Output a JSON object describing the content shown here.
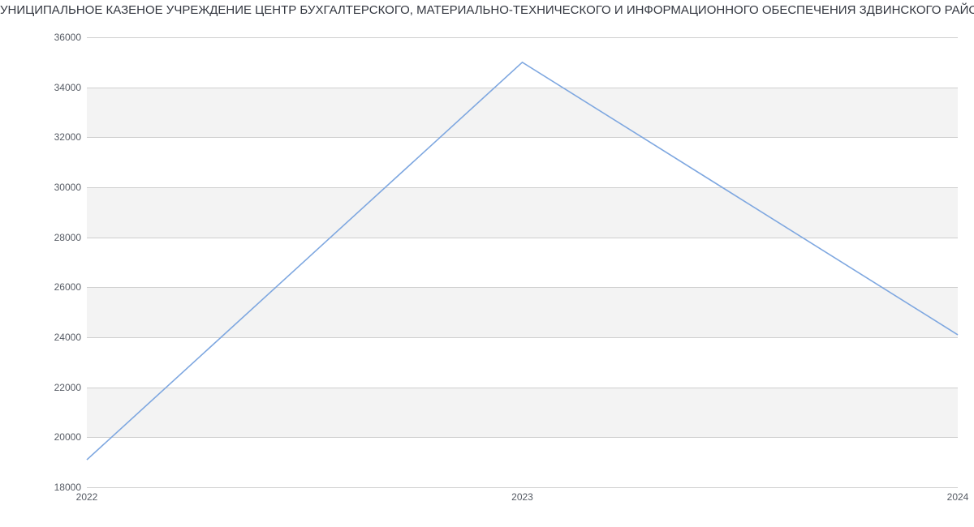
{
  "chart_data": {
    "type": "line",
    "title": "УНИЦИПАЛЬНОЕ КАЗЕНОЕ УЧРЕЖДЕНИЕ  ЦЕНТР БУХГАЛТЕРСКОГО, МАТЕРИАЛЬНО-ТЕХНИЧЕСКОГО И ИНФОРМАЦИОННОГО ОБЕСПЕЧЕНИЯ ЗДВИНСКОГО РАЙОНА | Данн",
    "x": [
      2022,
      2023,
      2024
    ],
    "values": [
      19100,
      35000,
      24100
    ],
    "xlabel": "",
    "ylabel": "",
    "ylim": [
      18000,
      36000
    ],
    "y_ticks": [
      18000,
      20000,
      22000,
      24000,
      26000,
      28000,
      30000,
      32000,
      34000,
      36000
    ],
    "x_ticks": [
      2022,
      2023,
      2024
    ],
    "colors": {
      "line": "#7ea7e0",
      "band": "#f3f3f3",
      "grid": "#cfcfcf"
    }
  }
}
